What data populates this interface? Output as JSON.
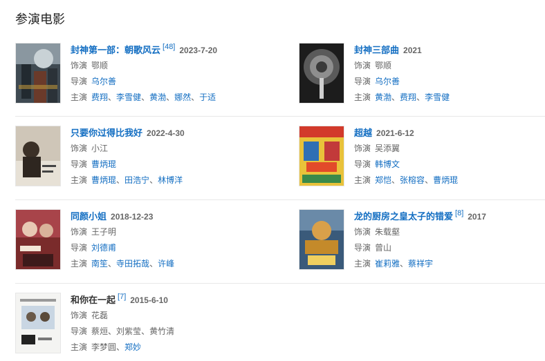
{
  "section_title": "参演电影",
  "films": [
    {
      "title": "封神第一部：朝歌风云",
      "ref": "[48]",
      "date": "2023-7-20",
      "role_label": "饰演",
      "role": "鄂顺",
      "director_label": "导演",
      "directors": [
        "乌尔善"
      ],
      "cast_label": "主演",
      "cast": [
        "费翔",
        "李雪健",
        "黄渤",
        "娜然",
        "于适"
      ]
    },
    {
      "title": "封神三部曲",
      "ref": "",
      "date": "2021",
      "role_label": "饰演",
      "role": "鄂顺",
      "director_label": "导演",
      "directors": [
        "乌尔善"
      ],
      "cast_label": "主演",
      "cast": [
        "黄渤",
        "费翔",
        "李雪健"
      ]
    },
    {
      "title": "只要你过得比我好",
      "ref": "",
      "date": "2022-4-30",
      "role_label": "饰演",
      "role": "小江",
      "director_label": "导演",
      "directors": [
        "曹炳琨"
      ],
      "cast_label": "主演",
      "cast": [
        "曹炳琨",
        "田浩宁",
        "林博洋"
      ]
    },
    {
      "title": "超越",
      "ref": "",
      "date": "2021-6-12",
      "role_label": "饰演",
      "role": "吴添翼",
      "director_label": "导演",
      "directors": [
        "韩博文"
      ],
      "cast_label": "主演",
      "cast": [
        "郑恺",
        "张榕容",
        "曹炳琨"
      ]
    },
    {
      "title": "同颜小姐",
      "ref": "",
      "date": "2018-12-23",
      "role_label": "饰演",
      "role": "王子明",
      "director_label": "导演",
      "directors": [
        "刘德甫"
      ],
      "cast_label": "主演",
      "cast": [
        "南笙",
        "寺田拓哉",
        "许峰"
      ]
    },
    {
      "title": "龙的厨房之皇太子的错爱",
      "ref": "[8]",
      "date": "2017",
      "role_label": "饰演",
      "role": "朱载壑",
      "director_label": "导演",
      "directors": [
        "曾山"
      ],
      "cast_label": "主演",
      "cast": [
        "崔莉雅",
        "蔡祥宇"
      ]
    },
    {
      "title": "和你在一起",
      "ref": "[7]",
      "date": "2015-6-10",
      "role_label": "饰演",
      "role": "花磊",
      "director_label": "导演",
      "directors": [
        "蔡烜",
        "刘紫莹",
        "黄竹清"
      ],
      "cast_label": "主演",
      "cast": [
        "李梦圆",
        "郑妙"
      ]
    }
  ],
  "colors": {
    "link": "#136ec2",
    "muted": "#666666",
    "divider": "#e8e8e8"
  }
}
